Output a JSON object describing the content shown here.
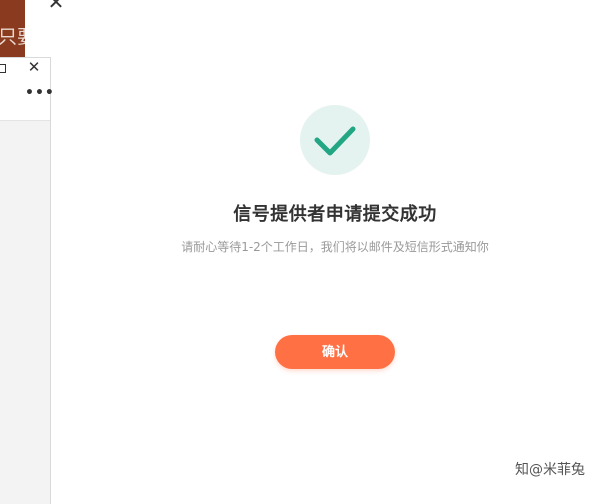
{
  "background_window": {
    "partial_text": "只要",
    "maximize_symbol": "",
    "close_symbol": "✕",
    "more_symbol": "•••"
  },
  "modal": {
    "close_symbol": "✕",
    "icon": "checkmark-icon",
    "title": "信号提供者申请提交成功",
    "subtitle": "请耐心等待1-2个工作日，我们将以邮件及短信形式通知你",
    "confirm_label": "确认"
  },
  "watermark": {
    "text": "知@米菲兔"
  },
  "colors": {
    "accent": "#ff7144",
    "success": "#22a684",
    "success_bg": "#e4f3ef",
    "title": "#333333",
    "subtitle": "#999999"
  }
}
